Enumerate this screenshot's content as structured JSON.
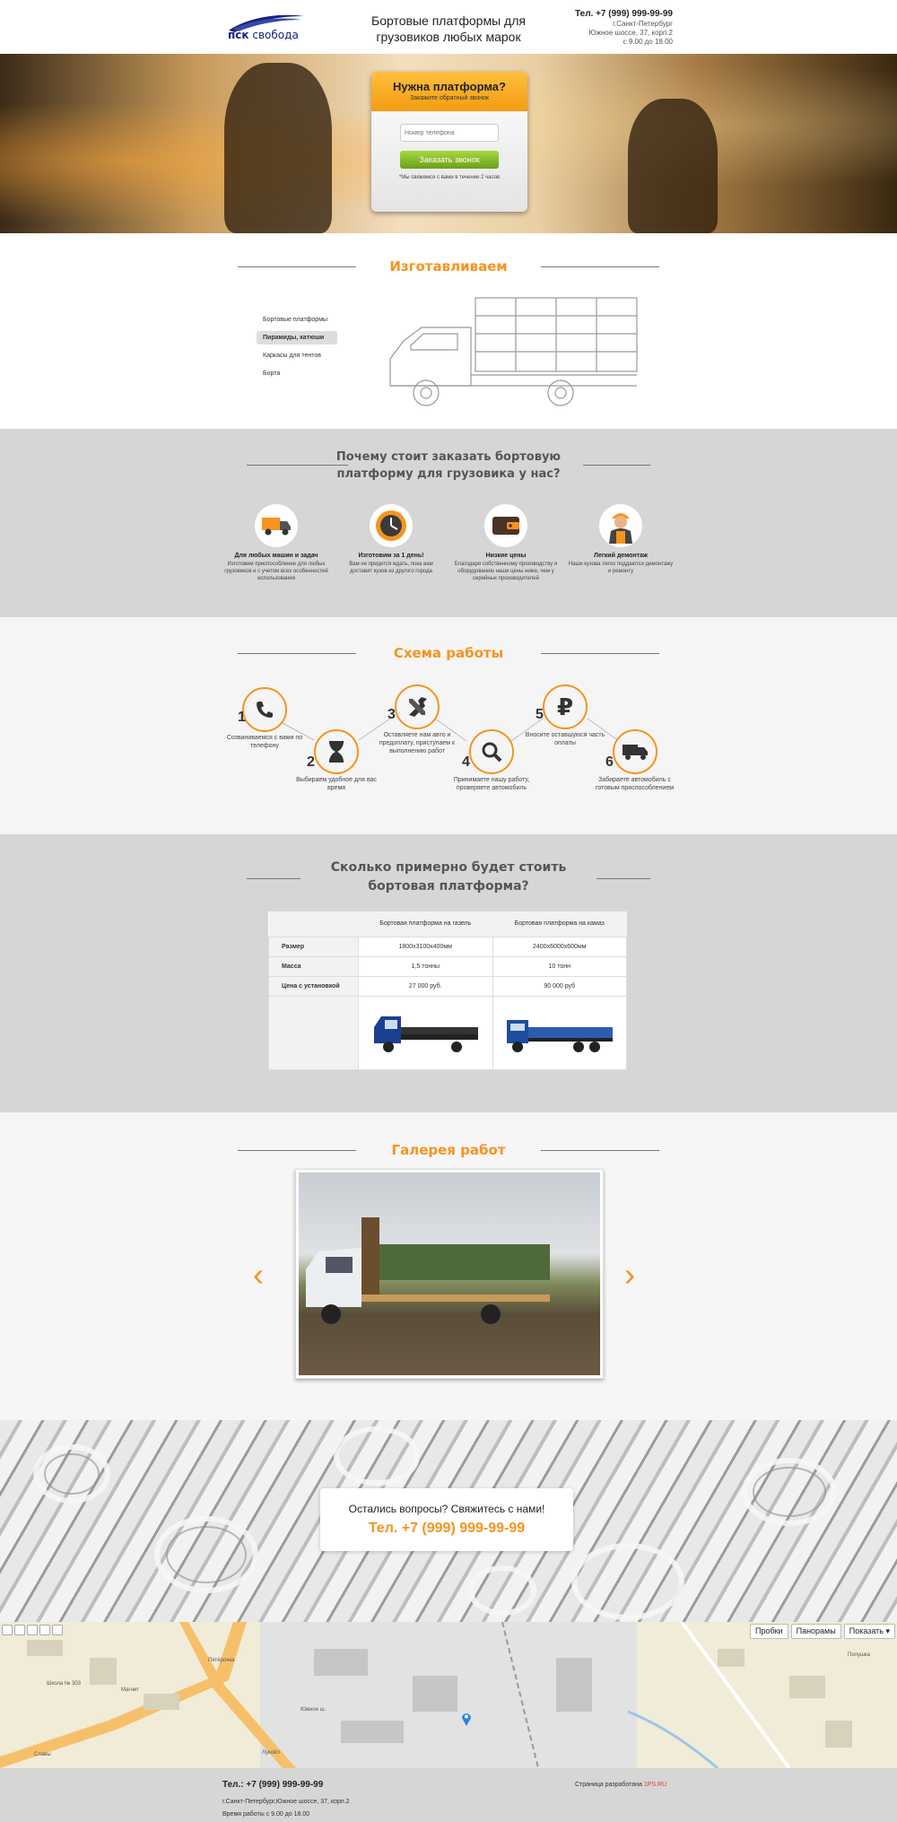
{
  "header": {
    "logo_prefix": "пск",
    "logo_name": "свобода",
    "title": "Бортовые платформы для грузовиков любых марок",
    "tel": "Тел. +7 (999) 999-99-99",
    "city": "г.Санкт-Петербург",
    "address": "Южное шоссе, 37, корп.2",
    "hours": "с 9.00 до 18.00"
  },
  "hero": {
    "form_title": "Нужна платформа?",
    "form_subtitle": "Закажите обратный звонок",
    "phone_placeholder": "Номер телефона",
    "button": "Заказать звонок",
    "note": "*Мы свяжемся с вами в течение 2 часов"
  },
  "manufacture": {
    "title": "Изготавливаем",
    "items": [
      "Бортовые платформы",
      "Пирамиды, катюши",
      "Каркасы для тентов",
      "Борта"
    ],
    "active_index": 1
  },
  "why": {
    "title_line1": "Почему стоит заказать бортовую",
    "title_line2": "платформу для грузовика у нас?",
    "items": [
      {
        "title": "Для любых машин и задач",
        "desc": "Изготовим приспособление для любых грузовиков и с учетом всех особенностей использования",
        "icon": "truck-icon"
      },
      {
        "title": "Изготовим за 1 день!",
        "desc": "Вам не придется ждать, пока вам доставят кузов из другого города",
        "icon": "clock-icon"
      },
      {
        "title": "Низкие цены",
        "desc": "Благодаря собственному производству и оборудованию наши цены ниже, чем у серийных производителей",
        "icon": "wallet-icon"
      },
      {
        "title": "Легкий демонтаж",
        "desc": "Наши кузова легко поддаются демонтажу и ремонту",
        "icon": "worker-icon"
      }
    ]
  },
  "scheme": {
    "title": "Схема работы",
    "steps": [
      {
        "num": "1",
        "text": "Созваниваемся с вами по телефону",
        "icon": "phone-icon"
      },
      {
        "num": "2",
        "text": "Выбираем удобное для вас время",
        "icon": "hourglass-icon"
      },
      {
        "num": "3",
        "text": "Оставляете нам авто и предоплату, приступаем к выполнению работ",
        "icon": "tools-icon"
      },
      {
        "num": "4",
        "text": "Принимаете нашу работу, проверяете автомобиль",
        "icon": "magnifier-icon"
      },
      {
        "num": "5",
        "text": "Вносите оставшуюся часть оплаты",
        "icon": "ruble-icon"
      },
      {
        "num": "6",
        "text": "Забираете автомобиль с готовым приспособлением",
        "icon": "delivery-truck-icon"
      }
    ]
  },
  "prices": {
    "title_line1": "Сколько примерно будет стоить",
    "title_line2": "бортовая платформа?",
    "columns": [
      "",
      "Бортовая платформа на газель",
      "Бортовая платформа на камаз"
    ],
    "rows": [
      {
        "label": "Размер",
        "gazel": "1800x3100x400мм",
        "kamaz": "2400x6000x600мм"
      },
      {
        "label": "Масса",
        "gazel": "1,5 тонны",
        "kamaz": "10 тонн"
      },
      {
        "label": "Цена с установкой",
        "gazel": "27 000 руб.",
        "kamaz": "90 000 руб"
      }
    ],
    "truck_colors": {
      "gazel": "#1d3f8f",
      "kamaz": "#1d4e9e"
    }
  },
  "gallery": {
    "title": "Галерея работ",
    "prev": "‹",
    "next": "›"
  },
  "contact": {
    "question": "Остались вопросы? Свяжитесь с нами!",
    "tel": "Тел. +7 (999) 999-99-99"
  },
  "map": {
    "buttons": [
      "Пробки",
      "Панорамы",
      "Показать ▾"
    ],
    "labels": [
      "Школа № 303",
      "Магнит",
      "Южное ш.",
      "Славы",
      "Лукойл",
      "Полушка",
      "Пятёрочка"
    ]
  },
  "footer": {
    "tel": "Тел.: +7   (999) 999-99-99",
    "address": "г.Санкт-Петербург,Южное шоссе, 37, корп.2",
    "hours": "Время работы с 9.00 до 18.00",
    "dev_text": "Страница разработана",
    "dev_link": "1PS.RU"
  },
  "colors": {
    "accent": "#f7931e",
    "gray_band": "#d6d6d6",
    "button_green": "#7cb820"
  }
}
